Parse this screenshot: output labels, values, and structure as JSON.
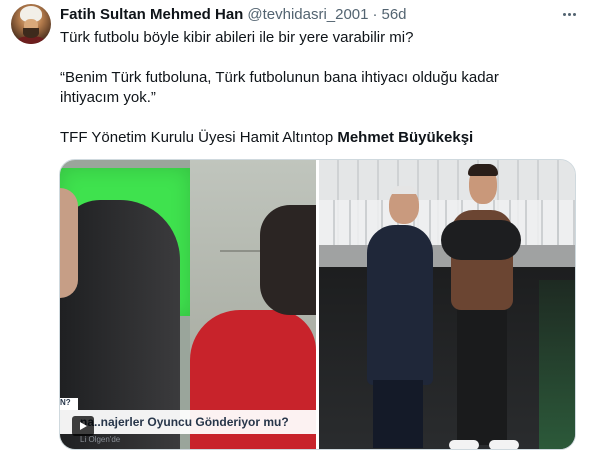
{
  "tweet": {
    "author_name": "Fatih Sultan Mehmed Han",
    "handle": "@tevhidasri_2001",
    "separator": "·",
    "time": "56d",
    "line1": "Türk futbolu böyle kibir abileri ile bir yere varabilir mi?",
    "quote_line1": "“Benim Türk futboluna, Türk futbolunun bana ihtiyacı olduğu kadar",
    "quote_line2": "ihtiyacım yok.”",
    "attribution_prefix": "TFF Yönetim Kurulu Üyesi Hamit Altıntop ",
    "attribution_bold": "Mehmet Büyükekşi"
  },
  "media": {
    "video_banner_text": "na..najerler Oyuncu Gönderiyor mu?",
    "video_banner_sub": "Li Olgen'de",
    "video_banner_q": "N?"
  },
  "icons": {
    "more": "more-horizontal-icon",
    "play": "play-icon"
  },
  "colors": {
    "text_primary": "#0f1419",
    "text_secondary": "#536471",
    "border": "#cfd9de"
  }
}
